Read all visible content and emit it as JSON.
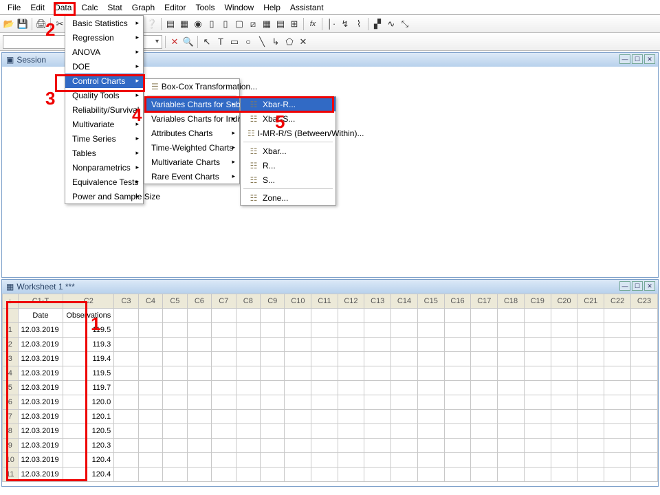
{
  "menubar": [
    "File",
    "Edit",
    "Data",
    "Calc",
    "Stat",
    "Graph",
    "Editor",
    "Tools",
    "Window",
    "Help",
    "Assistant"
  ],
  "session": {
    "title": "Session"
  },
  "worksheet": {
    "title": "Worksheet 1 ***"
  },
  "stat_menu": {
    "items": [
      {
        "label": "Basic Statistics",
        "sub": true
      },
      {
        "label": "Regression",
        "sub": true
      },
      {
        "label": "ANOVA",
        "sub": true
      },
      {
        "label": "DOE",
        "sub": true
      },
      {
        "label": "Control Charts",
        "sub": true,
        "hl": true
      },
      {
        "label": "Quality Tools",
        "sub": true
      },
      {
        "label": "Reliability/Survival",
        "sub": true
      },
      {
        "label": "Multivariate",
        "sub": true
      },
      {
        "label": "Time Series",
        "sub": true
      },
      {
        "label": "Tables",
        "sub": true
      },
      {
        "label": "Nonparametrics",
        "sub": true
      },
      {
        "label": "Equivalence Tests",
        "sub": true
      },
      {
        "label": "Power and Sample Size",
        "sub": true
      }
    ]
  },
  "cc_menu": {
    "items": [
      {
        "label": "Box-Cox Transformation...",
        "ico": "☰"
      },
      {
        "label": "Variables Charts for Subgroups",
        "sub": true,
        "hl": true
      },
      {
        "label": "Variables Charts for Individuals",
        "sub": true
      },
      {
        "label": "Attributes Charts",
        "sub": true
      },
      {
        "label": "Time-Weighted Charts",
        "sub": true
      },
      {
        "label": "Multivariate Charts",
        "sub": true
      },
      {
        "label": "Rare Event Charts",
        "sub": true
      }
    ]
  },
  "vcs_menu": {
    "items": [
      {
        "label": "Xbar-R...",
        "ico": "☷",
        "hl": true
      },
      {
        "label": "Xbar-S...",
        "ico": "☷"
      },
      {
        "label": "I-MR-R/S (Between/Within)...",
        "ico": "☷"
      },
      {
        "label": "Xbar...",
        "ico": "☷"
      },
      {
        "label": "R...",
        "ico": "☷"
      },
      {
        "label": "S...",
        "ico": "☷"
      },
      {
        "label": "Zone...",
        "ico": "☷"
      }
    ]
  },
  "cols": [
    "C1-T",
    "C2",
    "C3",
    "C4",
    "C5",
    "C6",
    "C7",
    "C8",
    "C9",
    "C10",
    "C11",
    "C12",
    "C13",
    "C14",
    "C15",
    "C16",
    "C17",
    "C18",
    "C19",
    "C20",
    "C21",
    "C22",
    "C23"
  ],
  "headers": {
    "c1": "Date",
    "c2": "Observations"
  },
  "rows": [
    {
      "n": 1,
      "d": "12.03.2019",
      "v": "119.5"
    },
    {
      "n": 2,
      "d": "12.03.2019",
      "v": "119.3"
    },
    {
      "n": 3,
      "d": "12.03.2019",
      "v": "119.4"
    },
    {
      "n": 4,
      "d": "12.03.2019",
      "v": "119.5"
    },
    {
      "n": 5,
      "d": "12.03.2019",
      "v": "119.7"
    },
    {
      "n": 6,
      "d": "12.03.2019",
      "v": "120.0"
    },
    {
      "n": 7,
      "d": "12.03.2019",
      "v": "120.1"
    },
    {
      "n": 8,
      "d": "12.03.2019",
      "v": "120.5"
    },
    {
      "n": 9,
      "d": "12.03.2019",
      "v": "120.3"
    },
    {
      "n": 10,
      "d": "12.03.2019",
      "v": "120.4"
    },
    {
      "n": 11,
      "d": "12.03.2019",
      "v": "120.4"
    }
  ],
  "ann": {
    "a1": "1",
    "a2": "2",
    "a3": "3",
    "a4": "4",
    "a5": "5"
  }
}
